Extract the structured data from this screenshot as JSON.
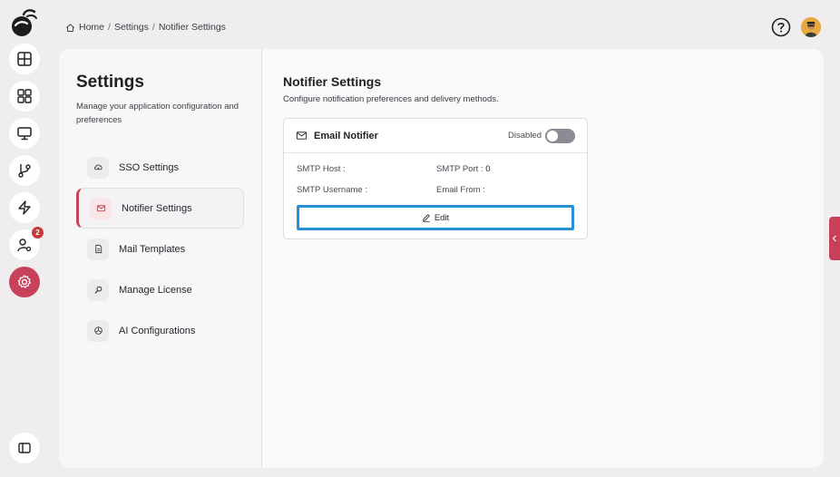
{
  "breadcrumb": {
    "home": "Home",
    "settings": "Settings",
    "current": "Notifier Settings",
    "separator": "/"
  },
  "rail": {
    "items": [
      {
        "icon": "layout-grid-icon"
      },
      {
        "icon": "dashboard-icon"
      },
      {
        "icon": "monitor-icon"
      },
      {
        "icon": "git-branch-icon"
      },
      {
        "icon": "lightning-icon"
      },
      {
        "icon": "user-settings-icon",
        "badge": "2"
      },
      {
        "icon": "gear-icon",
        "active": true
      },
      {
        "icon": "sidebar-toggle-icon"
      }
    ]
  },
  "side": {
    "title": "Settings",
    "description": "Manage your application configuration and preferences",
    "items": [
      {
        "label": "SSO Settings",
        "icon": "cloud-lock-icon"
      },
      {
        "label": "Notifier Settings",
        "icon": "mail-icon",
        "active": true
      },
      {
        "label": "Mail Templates",
        "icon": "file-icon"
      },
      {
        "label": "Manage License",
        "icon": "key-icon"
      },
      {
        "label": "AI Configurations",
        "icon": "ai-icon"
      }
    ]
  },
  "main": {
    "title": "Notifier Settings",
    "subtitle": "Configure notification preferences and delivery methods.",
    "notifier": {
      "title": "Email Notifier",
      "status": "Disabled",
      "smtp_host_label": "SMTP Host :",
      "smtp_port_label": "SMTP Port :",
      "smtp_port_value": "0",
      "smtp_username_label": "SMTP Username :",
      "email_from_label": "Email From :",
      "edit_label": "Edit"
    }
  },
  "colors": {
    "accent": "#c8415a",
    "focus": "#2a8fd6",
    "background": "#efedee"
  }
}
